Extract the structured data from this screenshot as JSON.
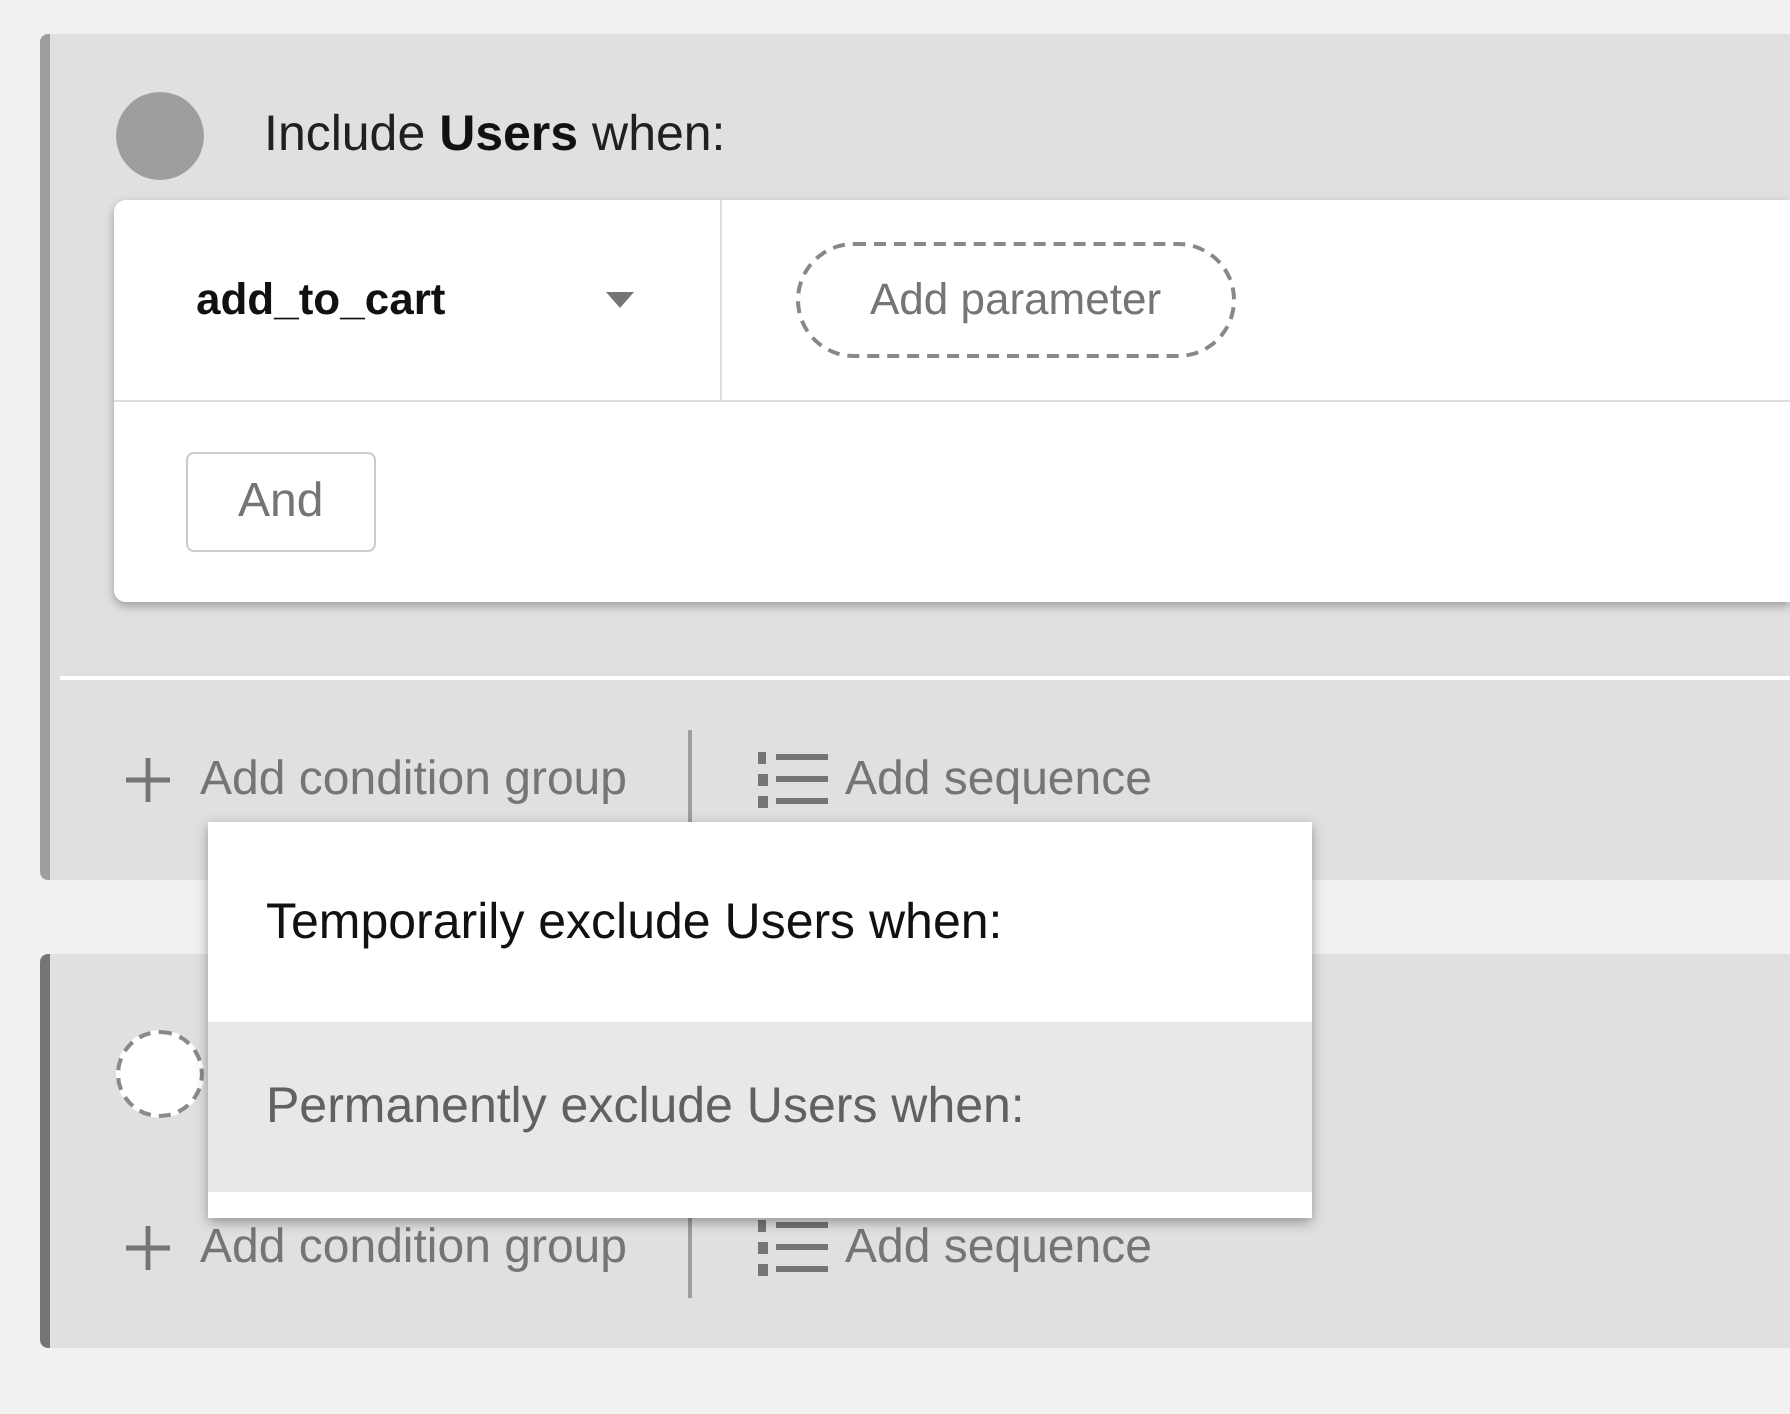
{
  "groups": [
    {
      "kind": "include",
      "title": "Include **Users** when:",
      "condition": {
        "event": "add_to_cart",
        "add_parameter": "Add parameter",
        "and_button": "And"
      },
      "footer": {
        "add_condition_group": "Add condition group",
        "add_sequence": "Add sequence"
      }
    },
    {
      "kind": "exclude",
      "footer": {
        "add_condition_group": "Add condition group",
        "add_sequence": "Add sequence"
      }
    }
  ],
  "exclude_menu": {
    "items": [
      {
        "label": "Temporarily exclude Users when:",
        "selected": false
      },
      {
        "label": "Permanently exclude Users when:",
        "selected": true
      }
    ]
  }
}
